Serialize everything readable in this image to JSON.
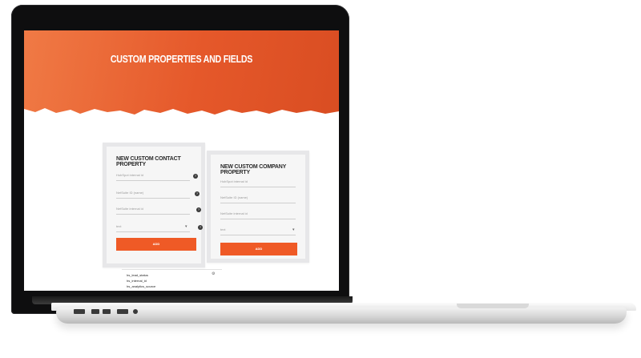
{
  "hero": {
    "title": "CUSTOM PROPERTIES AND FIELDS",
    "subtitle": ""
  },
  "contact_card": {
    "title": "NEW CUSTOM CONTACT PROPERTY",
    "fields": [
      {
        "placeholder": "HubSpot internal id"
      },
      {
        "placeholder": "NetSuite ID (name)"
      },
      {
        "placeholder": "NetSuite internal id"
      },
      {
        "placeholder": "text"
      }
    ],
    "button": "ADD"
  },
  "company_card": {
    "title": "NEW CUSTOM COMPANY PROPERTY",
    "fields": [
      {
        "placeholder": "HubSpot internal id"
      },
      {
        "placeholder": "NetSuite ID (name)"
      },
      {
        "placeholder": "NetSuite internal id"
      },
      {
        "placeholder": "text"
      }
    ],
    "button": "ADD"
  },
  "list": {
    "items": [
      "hs_lead_status",
      "hs_internal_id",
      "hs_analytics_source"
    ]
  },
  "colors": {
    "accent": "#ef5a26",
    "hero_start": "#f07a45",
    "hero_end": "#d94d22"
  }
}
